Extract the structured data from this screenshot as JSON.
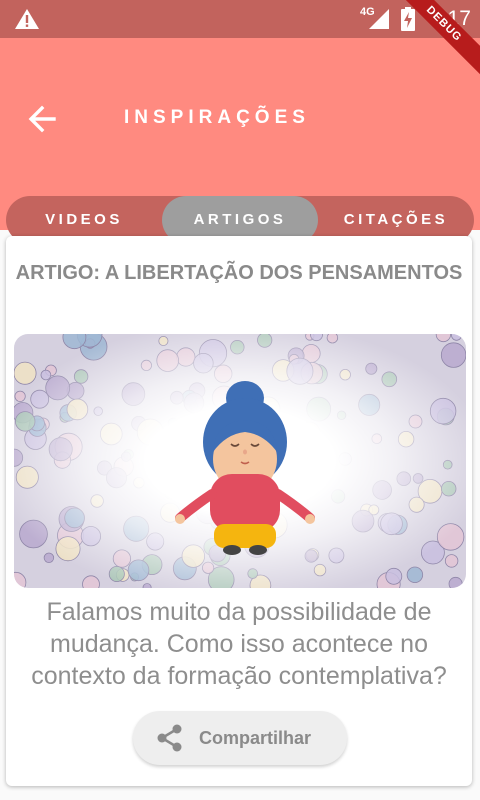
{
  "status_bar": {
    "network": "4G",
    "time": "5:17"
  },
  "debug_banner": "DEBUG",
  "app_bar": {
    "title": "INSPIRAÇÕES"
  },
  "tabs": [
    {
      "label": "VIDEOS",
      "selected": false
    },
    {
      "label": "ARTIGOS",
      "selected": true
    },
    {
      "label": "CITAÇÕES",
      "selected": false
    }
  ],
  "article": {
    "heading": "ARTIGO: A LIBERTAÇÃO DOS PENSAMENTOS",
    "image_icon": "meditating-woman-illustration",
    "excerpt": "Falamos muito da possibilidade de mudança. Como isso acontece no contexto da formação contemplativa?",
    "share_label": "Compartilhar",
    "share_icon": "share-icon"
  },
  "colors": {
    "status_bar": "#c2635d",
    "app_bar": "#ff8a80",
    "tab_track": "#c4645e",
    "tab_selected": "#9e9e9e",
    "text_muted": "#8a8a8a"
  }
}
